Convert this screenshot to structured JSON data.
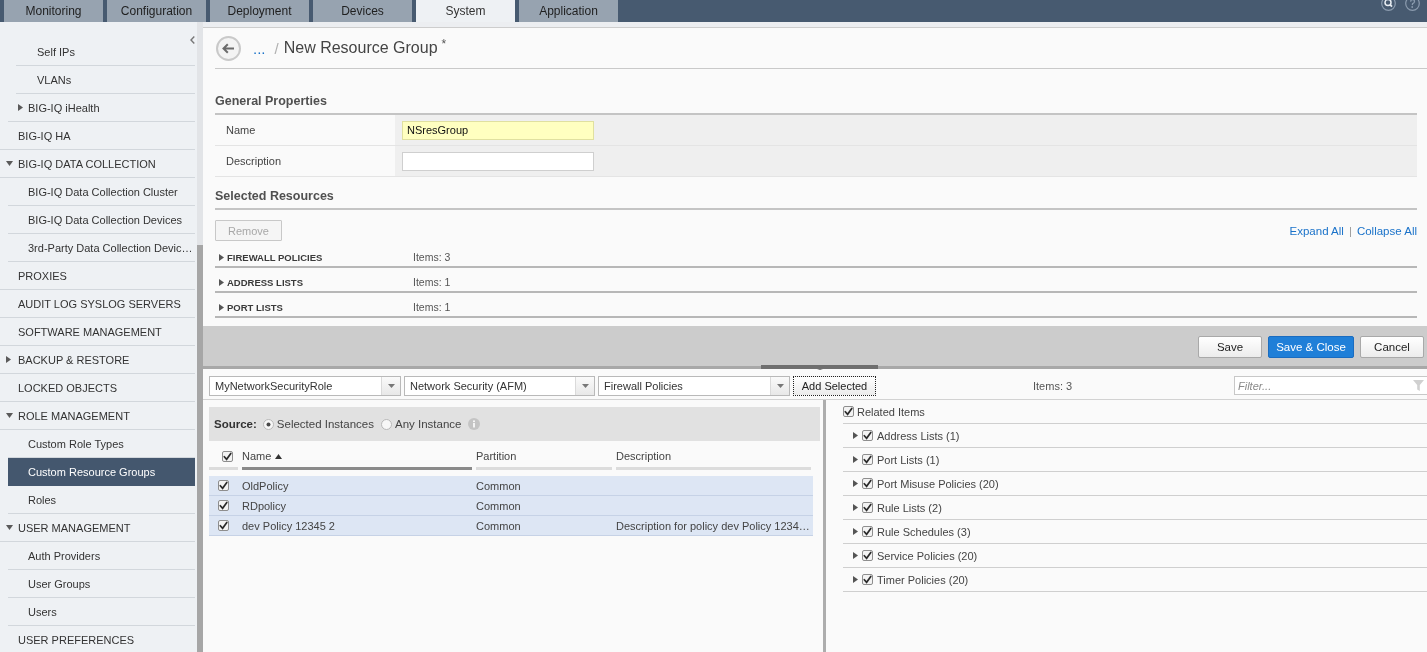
{
  "nav": {
    "tabs": [
      {
        "label": "Monitoring",
        "selected": false
      },
      {
        "label": "Configuration",
        "selected": false
      },
      {
        "label": "Deployment",
        "selected": false
      },
      {
        "label": "Devices",
        "selected": false
      },
      {
        "label": "System",
        "selected": true
      },
      {
        "label": "Application",
        "selected": false
      }
    ]
  },
  "sidebar": {
    "items": [
      {
        "children": [
          {
            "children": [
              {
                "label": "Self IPs",
                "selected": false
              },
              {
                "label": "VLANs",
                "selected": false
              }
            ]
          },
          {
            "label": "BIG-IQ iHealth",
            "expanded": false,
            "selected": false
          }
        ]
      },
      {
        "label": "BIG-IQ HA",
        "selected": false
      },
      {
        "label": "BIG-IQ DATA COLLECTION",
        "expanded": true,
        "selected": false,
        "children": [
          {
            "label": "BIG-IQ Data Collection Cluster",
            "selected": false
          },
          {
            "label": "BIG-IQ Data Collection Devices",
            "selected": false
          },
          {
            "label": "3rd-Party Data Collection Devic…",
            "selected": false
          }
        ]
      },
      {
        "label": "PROXIES",
        "selected": false
      },
      {
        "label": "AUDIT LOG SYSLOG SERVERS",
        "selected": false
      },
      {
        "label": "SOFTWARE MANAGEMENT",
        "selected": false
      },
      {
        "label": "BACKUP & RESTORE",
        "expanded": false,
        "selected": false
      },
      {
        "label": "LOCKED OBJECTS",
        "selected": false
      },
      {
        "label": "ROLE MANAGEMENT",
        "expanded": true,
        "selected": false,
        "children": [
          {
            "label": "Custom Role Types",
            "selected": false
          },
          {
            "label": "Custom Resource Groups",
            "selected": true
          },
          {
            "label": "Roles",
            "selected": false
          }
        ]
      },
      {
        "label": "USER MANAGEMENT",
        "expanded": true,
        "selected": false,
        "children": [
          {
            "label": "Auth Providers",
            "selected": false
          },
          {
            "label": "User Groups",
            "selected": false
          },
          {
            "label": "Users",
            "selected": false
          }
        ]
      },
      {
        "label": "USER PREFERENCES",
        "selected": false
      }
    ]
  },
  "header": {
    "breadcrumb": "...",
    "separator": "/",
    "title": "New Resource Group",
    "unsaved_mark": "*"
  },
  "general_properties": {
    "heading": "General Properties",
    "fields": [
      {
        "label": "Name",
        "value": "NSresGroup",
        "highlighted": true
      },
      {
        "label": "Description",
        "highlighted": false
      }
    ]
  },
  "selected_resources": {
    "heading": "Selected Resources",
    "remove_button": {
      "label": "Remove",
      "disabled": true
    },
    "links": [
      "Expand All",
      "Collapse All"
    ],
    "link_separator": "|",
    "groups": [
      {
        "label": "FIREWALL POLICIES",
        "count": "Items: 3",
        "expanded": false
      },
      {
        "label": "ADDRESS LISTS",
        "count": "Items: 1",
        "expanded": false
      },
      {
        "label": "PORT LISTS",
        "count": "Items: 1",
        "expanded": false
      }
    ]
  },
  "actions": [
    {
      "label": "Save",
      "kind": "secondary"
    },
    {
      "label": "Save & Close",
      "kind": "primary"
    },
    {
      "label": "Cancel",
      "kind": "secondary"
    }
  ],
  "picker": {
    "dropdowns": [
      "MyNetworkSecurityRole",
      "Network Security (AFM)",
      "Firewall Policies"
    ],
    "add_button": "Add Selected",
    "count": "Items: 3",
    "filter": {
      "placeholder": "Filter..."
    }
  },
  "source": {
    "label": "Source:",
    "options": [
      {
        "label": "Selected Instances",
        "selected": true
      },
      {
        "label": "Any Instance",
        "selected": false
      }
    ]
  },
  "table": {
    "all_checked": true,
    "columns": [
      {
        "label": "Name",
        "sorted": true,
        "ascending": true
      },
      {
        "label": "Partition",
        "sorted": false
      },
      {
        "label": "Description",
        "sorted": false
      }
    ],
    "rows": [
      {
        "checked": true,
        "selected": true,
        "cells": [
          "OldPolicy",
          "Common"
        ]
      },
      {
        "checked": true,
        "selected": true,
        "cells": [
          "RDpolicy",
          "Common"
        ]
      },
      {
        "checked": true,
        "selected": true,
        "cells": [
          "dev Policy 12345 2",
          "Common",
          "Description for policy dev Policy 1234…"
        ]
      }
    ]
  },
  "related": {
    "label": "Related Items",
    "checked": true,
    "children": [
      {
        "label": "Address Lists (1)",
        "checked": true,
        "expanded": false
      },
      {
        "label": "Port Lists (1)",
        "checked": true,
        "expanded": false
      },
      {
        "label": "Port Misuse Policies (20)",
        "checked": true,
        "expanded": false
      },
      {
        "label": "Rule Lists (2)",
        "checked": true,
        "expanded": false
      },
      {
        "label": "Rule Schedules (3)",
        "checked": true,
        "expanded": false
      },
      {
        "label": "Service Policies (20)",
        "checked": true,
        "expanded": false
      },
      {
        "label": "Timer Policies (20)",
        "checked": true,
        "expanded": false
      }
    ]
  }
}
